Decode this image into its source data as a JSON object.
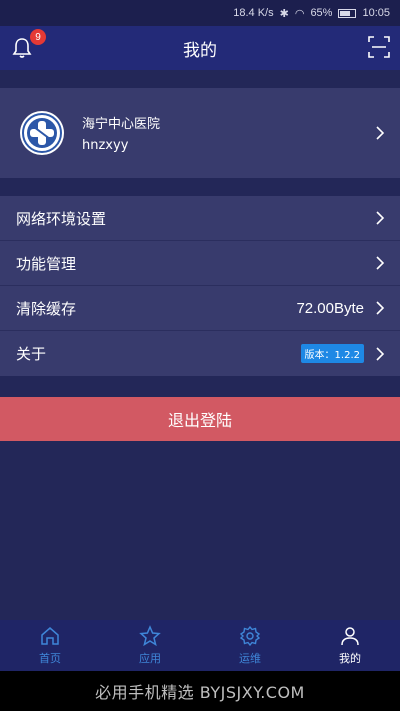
{
  "status_bar": {
    "speed": "18.4 K/s",
    "battery": "65%",
    "time": "10:05"
  },
  "header": {
    "title": "我的",
    "notification_count": "9"
  },
  "hospital": {
    "name": "海宁中心医院",
    "code": "hnzxyy"
  },
  "menu": {
    "items": [
      {
        "label": "网络环境设置"
      },
      {
        "label": "功能管理"
      },
      {
        "label": "清除缓存",
        "value": "72.00Byte"
      },
      {
        "label": "关于",
        "badge": "版本：1.2.2"
      }
    ]
  },
  "logout": {
    "label": "退出登陆"
  },
  "bottom_nav": {
    "items": [
      {
        "label": "首页",
        "icon": "home-icon"
      },
      {
        "label": "应用",
        "icon": "star-icon"
      },
      {
        "label": "运维",
        "icon": "gear-icon"
      },
      {
        "label": "我的",
        "icon": "user-icon"
      }
    ]
  },
  "system_bar": {
    "watermark": "必用手机精选 BYJSJXY.COM"
  },
  "colors": {
    "background": "#232758",
    "card": "#383b6d",
    "header": "#232a78",
    "logout": "#d25963",
    "nav_inactive": "#3f86d8",
    "version_badge": "#1e88e5"
  }
}
